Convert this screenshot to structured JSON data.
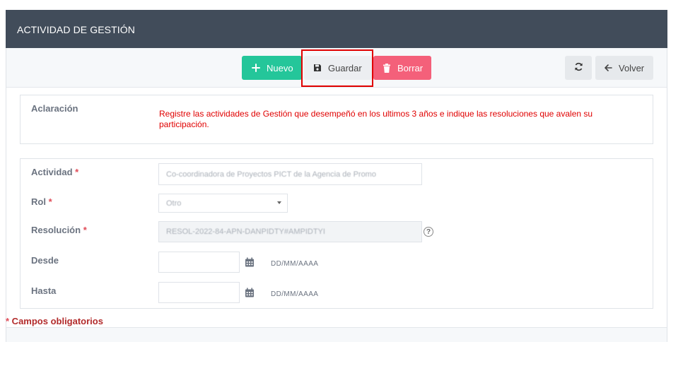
{
  "header": {
    "title": "ACTIVIDAD DE GESTIÓN"
  },
  "toolbar": {
    "nuevo_label": "Nuevo",
    "guardar_label": "Guardar",
    "borrar_label": "Borrar",
    "volver_label": "Volver",
    "icons": {
      "nuevo": "plus-icon",
      "guardar": "save-icon",
      "borrar": "trash-icon",
      "refresh": "refresh-icon",
      "volver": "arrow-left-icon"
    }
  },
  "aclaracion": {
    "label": "Aclaración",
    "text": "Registre las actividades de Gestión que desempeñó en los ultimos 3 años e indique las resoluciones que avalen su participación."
  },
  "form": {
    "actividad": {
      "label": "Actividad",
      "required_mark": "*",
      "value": "Co-coordinadora de Proyectos PICT de la Agencia de Promo"
    },
    "rol": {
      "label": "Rol",
      "required_mark": "*",
      "value": "Otro"
    },
    "resolucion": {
      "label": "Resolución",
      "required_mark": "*",
      "value": "RESOL-2022-84-APN-DANPIDTY#AMPIDTYI",
      "help": "?"
    },
    "desde": {
      "label": "Desde",
      "placeholder": "",
      "format_hint": "DD/MM/AAAA"
    },
    "hasta": {
      "label": "Hasta",
      "placeholder": "",
      "format_hint": "DD/MM/AAAA"
    }
  },
  "footer": {
    "required_star": "*",
    "required_note": " Campos obligatorios"
  },
  "colors": {
    "header_bg": "#414c5a",
    "nuevo": "#24c69a",
    "borrar": "#f4607a",
    "highlight": "#e00000",
    "aclaracion_text": "#e00000"
  }
}
